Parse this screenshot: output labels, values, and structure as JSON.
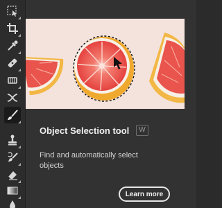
{
  "toolbar": {
    "tools": [
      {
        "name": "object-selection-tool-icon",
        "active": false
      },
      {
        "name": "crop-tool-icon",
        "active": false
      },
      {
        "name": "eyedropper-tool-icon",
        "active": false
      },
      {
        "name": "spot-healing-brush-icon",
        "active": false
      },
      {
        "name": "patch-tool-icon",
        "active": false
      },
      {
        "name": "content-aware-move-icon",
        "active": false
      },
      {
        "name": "red-eye-tool-icon",
        "active": false
      },
      {
        "name": "brush-tool-icon",
        "active": true
      },
      {
        "name": "clone-stamp-icon",
        "active": false
      },
      {
        "name": "history-brush-icon",
        "active": false
      },
      {
        "name": "eraser-tool-icon",
        "active": false
      },
      {
        "name": "gradient-tool-icon",
        "active": false
      },
      {
        "name": "blur-tool-icon",
        "active": false
      }
    ]
  },
  "tooltip": {
    "title": "Object Selection tool",
    "shortcut": "W",
    "description": "Find and automatically select objects",
    "learn_more": "Learn more"
  },
  "colors": {
    "accent_grapefruit": "#e8534c",
    "peel": "#f0b23a",
    "background": "#323232"
  }
}
